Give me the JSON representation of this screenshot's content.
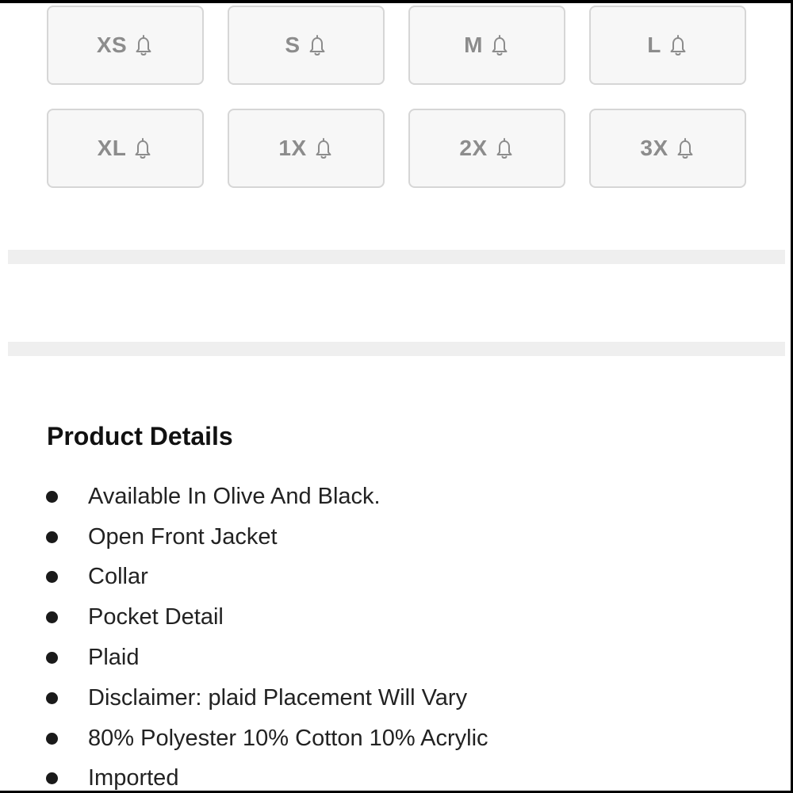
{
  "sizes": [
    {
      "label": "XS",
      "icon": "bell-icon"
    },
    {
      "label": "S",
      "icon": "bell-icon"
    },
    {
      "label": "M",
      "icon": "bell-icon"
    },
    {
      "label": "L",
      "icon": "bell-icon"
    },
    {
      "label": "XL",
      "icon": "bell-icon"
    },
    {
      "label": "1X",
      "icon": "bell-icon"
    },
    {
      "label": "2X",
      "icon": "bell-icon"
    },
    {
      "label": "3X",
      "icon": "bell-icon"
    }
  ],
  "product_details": {
    "title": "Product Details",
    "items": [
      "Available In Olive And Black.",
      "Open Front Jacket",
      "Collar",
      "Pocket Detail",
      "Plaid",
      "Disclaimer: plaid Placement Will Vary",
      "80% Polyester 10% Cotton 10% Acrylic",
      "Imported"
    ]
  },
  "colors": {
    "button_background": "#f7f7f7",
    "button_border": "#d6d6d6",
    "button_text": "#8c8c8c",
    "divider": "#efefef",
    "heading_text": "#111111",
    "body_text": "#222222"
  }
}
